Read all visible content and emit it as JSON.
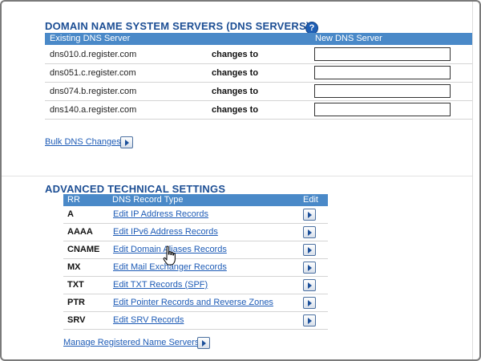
{
  "dns": {
    "title": "DOMAIN NAME SYSTEM SERVERS (DNS SERVERS)",
    "help_icon": "?",
    "col_existing": "Existing DNS Server",
    "col_new": "New DNS Server",
    "changes_label": "changes to",
    "rows": [
      {
        "server": "dns010.d.register.com",
        "new_value": ""
      },
      {
        "server": "dns051.c.register.com",
        "new_value": ""
      },
      {
        "server": "dns074.b.register.com",
        "new_value": ""
      },
      {
        "server": "dns140.a.register.com",
        "new_value": ""
      }
    ],
    "bulk_link": "Bulk DNS Changes"
  },
  "advanced": {
    "title": "ADVANCED TECHNICAL SETTINGS",
    "col_rr": "RR",
    "col_type": "DNS Record Type",
    "col_edit": "Edit",
    "rows": [
      {
        "rr": "A",
        "label": "Edit IP Address Records"
      },
      {
        "rr": "AAAA",
        "label": "Edit IPv6 Address Records"
      },
      {
        "rr": "CNAME",
        "label": "Edit Domain Aliases Records"
      },
      {
        "rr": "MX",
        "label": "Edit Mail Exchanger Records"
      },
      {
        "rr": "TXT",
        "label": "Edit TXT Records (SPF)"
      },
      {
        "rr": "PTR",
        "label": "Edit Pointer Records and Reverse Zones"
      },
      {
        "rr": "SRV",
        "label": "Edit SRV Records"
      }
    ],
    "manage_link": "Manage Registered Name Servers"
  },
  "colors": {
    "heading": "#1c4e94",
    "header_bar": "#4a89c8",
    "link": "#1d5bb6"
  },
  "icons": {
    "help": "help-icon",
    "go_arrow": "go-arrow-icon",
    "cursor": "hand-pointer-icon"
  }
}
